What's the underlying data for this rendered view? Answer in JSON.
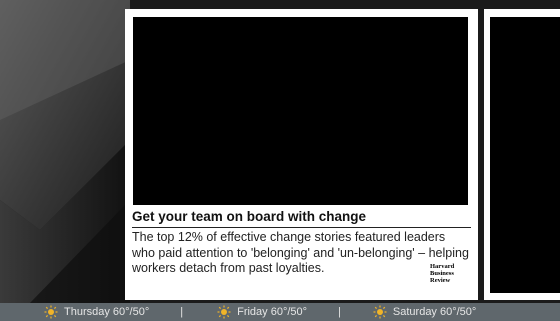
{
  "card": {
    "headline": "Get your team on board with change",
    "body": "The top 12% of effective change stories featured leaders who paid attention to 'belonging' and 'un-belonging' – helping workers detach from past loyalties.",
    "publisher_logo": {
      "line1": "Harvard",
      "line2": "Business",
      "line3": "Review"
    }
  },
  "weather": {
    "separator": "|",
    "days": [
      {
        "label": "Thursday 60°/50°",
        "icon": "sun-icon"
      },
      {
        "label": "Friday 60°/50°",
        "icon": "sun-icon"
      },
      {
        "label": "Saturday 60°/50°",
        "icon": "sun-icon"
      }
    ]
  },
  "colors": {
    "background": "#1a1a1a",
    "weather_bar": "#5f676c",
    "sun": "#f0b429",
    "card": "#ffffff",
    "media": "#000000"
  }
}
